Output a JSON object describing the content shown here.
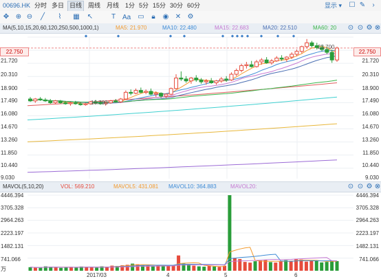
{
  "header": {
    "code": "00696.HK",
    "tabs": [
      "分时",
      "多日",
      "日线",
      "周线",
      "月线",
      "1分",
      "5分",
      "15分",
      "30分",
      "60分"
    ],
    "active_tab": "日线",
    "display_label": "显示"
  },
  "toolbar": {
    "icons": [
      "move-icon",
      "zoom-in-icon",
      "zoom-out-icon",
      "draw-tool-icon",
      "shape-tool-icon",
      "grid-icon",
      "arrow-icon",
      "text-icon",
      "eye-icon",
      "delete-icon",
      "lock-icon",
      "settings-icon"
    ],
    "text_button": "Aa"
  },
  "main_legend": {
    "label": "MA(5,10,15,20,60,120,250,500,1000,1)",
    "items": [
      {
        "label": "MA5: 21.970",
        "color": "#f29a2e"
      },
      {
        "label": "MA10: 22.480",
        "color": "#3d8bd6"
      },
      {
        "label": "MA15: 22.683",
        "color": "#c679d2"
      },
      {
        "label": "MA20: 22.510",
        "color": "#4a6fb3"
      },
      {
        "label": "MA60: 20",
        "color": "#3ab54a"
      }
    ]
  },
  "price_axis": [
    "22.750",
    "21.720",
    "20.310",
    "18.900",
    "17.490",
    "16.080",
    "14.670",
    "13.260",
    "11.850",
    "10.440",
    "9.030"
  ],
  "current_price": "22.750",
  "annotations": {
    "low": "16.700",
    "high": "23.700"
  },
  "volume_legend": {
    "label": "MAVOL(5,10,20)",
    "items": [
      {
        "label": "VOL: 569.210",
        "color": "#e64b3c"
      },
      {
        "label": "MAVOL5: 431.081",
        "color": "#f29a2e"
      },
      {
        "label": "MAVOL10: 364.883",
        "color": "#3d8bd6"
      },
      {
        "label": "MAVOL20:",
        "color": "#c679d2"
      }
    ]
  },
  "volume_axis": [
    "4446.394",
    "3705.328",
    "2964.263",
    "2223.197",
    "1482.131",
    "741.066"
  ],
  "volume_unit": "万",
  "x_axis": [
    "2017/03",
    "4",
    "5",
    "6"
  ],
  "chart_data": {
    "type": "candlestick",
    "price_ylim": [
      9.03,
      23.7
    ],
    "candles": [
      {
        "o": 17.4,
        "h": 17.6,
        "l": 17.1,
        "c": 17.2
      },
      {
        "o": 17.2,
        "h": 17.5,
        "l": 17.0,
        "c": 17.4
      },
      {
        "o": 17.4,
        "h": 17.6,
        "l": 17.2,
        "c": 17.3
      },
      {
        "o": 17.3,
        "h": 17.5,
        "l": 17.1,
        "c": 17.2
      },
      {
        "o": 17.2,
        "h": 17.4,
        "l": 16.9,
        "c": 17.0
      },
      {
        "o": 17.0,
        "h": 17.3,
        "l": 16.9,
        "c": 17.2
      },
      {
        "o": 17.2,
        "h": 17.3,
        "l": 16.9,
        "c": 17.0
      },
      {
        "o": 17.0,
        "h": 17.2,
        "l": 16.8,
        "c": 16.9
      },
      {
        "o": 16.9,
        "h": 17.1,
        "l": 16.7,
        "c": 17.0
      },
      {
        "o": 17.0,
        "h": 17.2,
        "l": 16.8,
        "c": 16.9
      },
      {
        "o": 16.9,
        "h": 17.1,
        "l": 16.7,
        "c": 16.8
      },
      {
        "o": 16.8,
        "h": 17.0,
        "l": 16.7,
        "c": 16.9
      },
      {
        "o": 16.9,
        "h": 17.2,
        "l": 16.8,
        "c": 17.1
      },
      {
        "o": 17.1,
        "h": 17.3,
        "l": 16.9,
        "c": 17.0
      },
      {
        "o": 17.0,
        "h": 17.2,
        "l": 16.8,
        "c": 16.9
      },
      {
        "o": 16.9,
        "h": 17.1,
        "l": 16.7,
        "c": 17.0
      },
      {
        "o": 17.0,
        "h": 17.3,
        "l": 16.9,
        "c": 17.2
      },
      {
        "o": 17.2,
        "h": 17.4,
        "l": 17.0,
        "c": 17.1
      },
      {
        "o": 17.1,
        "h": 17.5,
        "l": 17.0,
        "c": 17.4
      },
      {
        "o": 17.4,
        "h": 18.3,
        "l": 17.3,
        "c": 18.1
      },
      {
        "o": 18.1,
        "h": 18.4,
        "l": 17.8,
        "c": 18.0
      },
      {
        "o": 18.0,
        "h": 18.5,
        "l": 17.9,
        "c": 18.3
      },
      {
        "o": 18.3,
        "h": 18.6,
        "l": 18.0,
        "c": 18.1
      },
      {
        "o": 18.1,
        "h": 18.4,
        "l": 17.9,
        "c": 18.2
      },
      {
        "o": 18.2,
        "h": 18.5,
        "l": 17.8,
        "c": 17.9
      },
      {
        "o": 17.9,
        "h": 18.2,
        "l": 17.6,
        "c": 18.0
      },
      {
        "o": 18.0,
        "h": 18.1,
        "l": 17.5,
        "c": 17.7
      },
      {
        "o": 17.7,
        "h": 18.0,
        "l": 17.5,
        "c": 17.9
      },
      {
        "o": 17.9,
        "h": 18.6,
        "l": 17.8,
        "c": 18.5
      },
      {
        "o": 18.5,
        "h": 20.0,
        "l": 18.4,
        "c": 19.6
      },
      {
        "o": 19.6,
        "h": 20.3,
        "l": 19.3,
        "c": 19.5
      },
      {
        "o": 19.5,
        "h": 19.8,
        "l": 19.1,
        "c": 19.3
      },
      {
        "o": 19.3,
        "h": 19.7,
        "l": 19.0,
        "c": 19.6
      },
      {
        "o": 19.6,
        "h": 19.9,
        "l": 19.2,
        "c": 19.4
      },
      {
        "o": 19.4,
        "h": 19.6,
        "l": 19.0,
        "c": 19.2
      },
      {
        "o": 19.2,
        "h": 19.5,
        "l": 18.9,
        "c": 19.3
      },
      {
        "o": 19.3,
        "h": 19.6,
        "l": 19.0,
        "c": 19.1
      },
      {
        "o": 19.1,
        "h": 19.4,
        "l": 18.9,
        "c": 19.3
      },
      {
        "o": 19.3,
        "h": 19.7,
        "l": 19.1,
        "c": 19.5
      },
      {
        "o": 19.5,
        "h": 19.8,
        "l": 19.2,
        "c": 19.4
      },
      {
        "o": 19.4,
        "h": 20.2,
        "l": 19.3,
        "c": 20.0
      },
      {
        "o": 20.0,
        "h": 20.6,
        "l": 19.8,
        "c": 20.4
      },
      {
        "o": 20.4,
        "h": 21.1,
        "l": 20.2,
        "c": 20.9
      },
      {
        "o": 20.9,
        "h": 21.3,
        "l": 20.6,
        "c": 21.0
      },
      {
        "o": 21.0,
        "h": 21.4,
        "l": 20.7,
        "c": 20.8
      },
      {
        "o": 20.8,
        "h": 21.5,
        "l": 20.7,
        "c": 21.3
      },
      {
        "o": 21.3,
        "h": 21.7,
        "l": 21.0,
        "c": 21.5
      },
      {
        "o": 21.5,
        "h": 21.8,
        "l": 21.1,
        "c": 21.2
      },
      {
        "o": 21.2,
        "h": 21.6,
        "l": 21.0,
        "c": 21.4
      },
      {
        "o": 21.4,
        "h": 21.9,
        "l": 21.3,
        "c": 21.7
      },
      {
        "o": 21.7,
        "h": 22.0,
        "l": 21.4,
        "c": 21.6
      },
      {
        "o": 21.6,
        "h": 21.9,
        "l": 21.3,
        "c": 21.8
      },
      {
        "o": 21.8,
        "h": 22.3,
        "l": 21.6,
        "c": 22.1
      },
      {
        "o": 22.1,
        "h": 22.6,
        "l": 21.9,
        "c": 22.4
      },
      {
        "o": 22.4,
        "h": 23.0,
        "l": 22.2,
        "c": 22.9
      },
      {
        "o": 22.9,
        "h": 23.7,
        "l": 22.7,
        "c": 23.3
      },
      {
        "o": 23.3,
        "h": 23.5,
        "l": 22.8,
        "c": 23.0
      },
      {
        "o": 23.0,
        "h": 23.3,
        "l": 22.6,
        "c": 22.8
      },
      {
        "o": 22.8,
        "h": 23.1,
        "l": 22.4,
        "c": 22.6
      },
      {
        "o": 22.6,
        "h": 22.9,
        "l": 22.1,
        "c": 22.3
      },
      {
        "o": 22.3,
        "h": 22.6,
        "l": 21.2,
        "c": 21.5
      },
      {
        "o": 21.5,
        "h": 22.9,
        "l": 21.3,
        "c": 22.75
      }
    ],
    "volume_ylim": [
      0,
      4446.394
    ],
    "volumes": [
      210,
      190,
      180,
      260,
      240,
      200,
      170,
      190,
      230,
      210,
      250,
      220,
      200,
      180,
      260,
      240,
      300,
      280,
      320,
      350,
      420,
      380,
      330,
      300,
      280,
      310,
      290,
      270,
      340,
      900,
      420,
      380,
      300,
      260,
      240,
      280,
      250,
      230,
      290,
      4446,
      760,
      690,
      520,
      480,
      560,
      600,
      640,
      510,
      480,
      560,
      620,
      590,
      700,
      660,
      540,
      580,
      610,
      490,
      520,
      600,
      569
    ]
  }
}
